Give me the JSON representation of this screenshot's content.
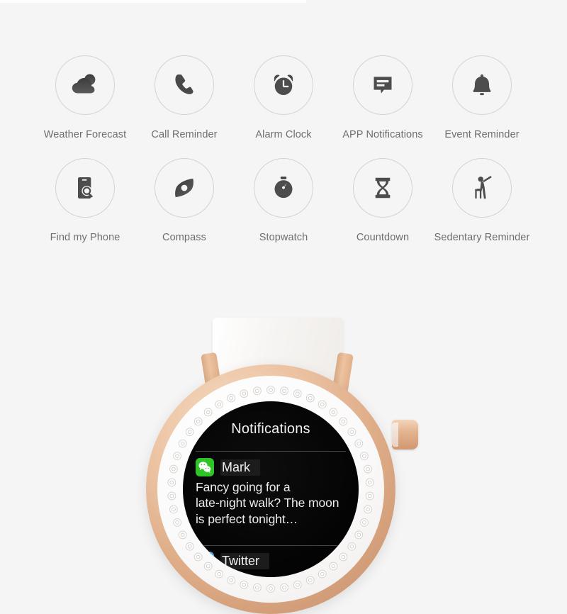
{
  "features": {
    "row1": [
      {
        "label": "Weather Forecast",
        "icon": "cloud-sun-icon"
      },
      {
        "label": "Call Reminder",
        "icon": "phone-icon"
      },
      {
        "label": "Alarm Clock",
        "icon": "alarm-clock-icon"
      },
      {
        "label": "APP Notifications",
        "icon": "message-bubble-icon"
      },
      {
        "label": "Event Reminder",
        "icon": "bell-icon"
      }
    ],
    "row2": [
      {
        "label": "Find my Phone",
        "icon": "phone-search-icon"
      },
      {
        "label": "Compass",
        "icon": "compass-icon"
      },
      {
        "label": "Stopwatch",
        "icon": "stopwatch-icon"
      },
      {
        "label": "Countdown",
        "icon": "hourglass-icon"
      },
      {
        "label": "Sedentary Reminder",
        "icon": "sedentary-person-icon"
      }
    ]
  },
  "watch": {
    "screen": {
      "title": "Notifications",
      "notifications": [
        {
          "app": "wechat-icon",
          "sender": "Mark",
          "body": "Fancy going for a\nlate-night walk? The moon\nis perfect tonight…"
        },
        {
          "app": "twitter-icon",
          "sender": "Twitter",
          "body": ""
        }
      ]
    }
  },
  "colors": {
    "background": "#f5f5f5",
    "icon_gray": "#4a4a4a",
    "label_gray": "#6e6e6e",
    "circle_border": "#d2d2d2",
    "rose_gold": "#e3b48f",
    "bezel_white": "#fbfafa",
    "screen_black": "#050505",
    "wechat_green": "#2fc425",
    "twitter_blue": "#4a9fe8"
  }
}
